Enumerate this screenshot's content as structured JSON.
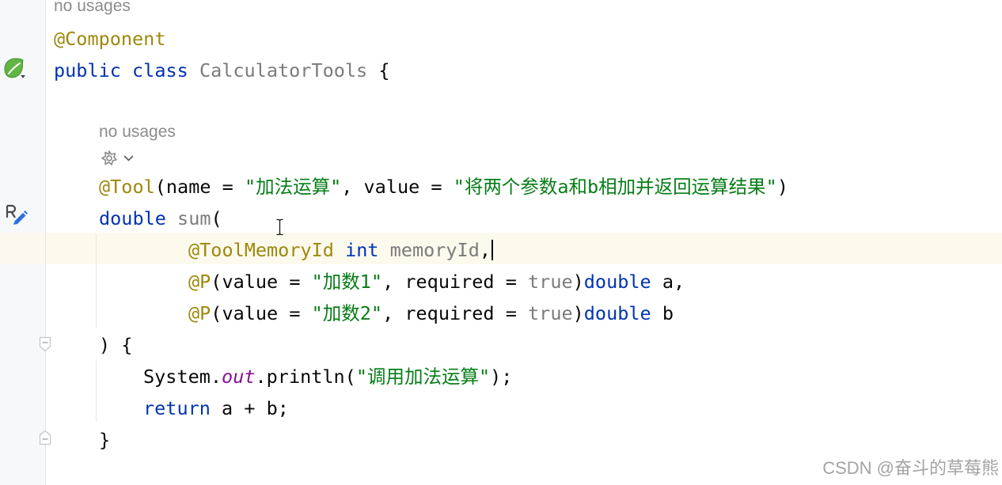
{
  "inlay_hints": {
    "class_usages": "no usages",
    "method_usages": "no usages"
  },
  "code": {
    "component_annotation": [
      "@Component"
    ],
    "class_declaration": [
      "public class ",
      "CalculatorTools",
      " {"
    ],
    "tool_annotation": [
      "@Tool",
      "(name = ",
      "\"加法运算\"",
      ", value = ",
      "\"将两个参数a和b相加并返回运算结果\"",
      ")"
    ],
    "method_signature": [
      "double ",
      "sum",
      "("
    ],
    "param_memory_id": [
      "@ToolMemoryId ",
      "int ",
      "memoryId",
      ","
    ],
    "param_a": [
      "@P",
      "(value = ",
      "\"加数1\"",
      ", required = ",
      "true",
      ")",
      "double",
      " a,"
    ],
    "param_b": [
      "@P",
      "(value = ",
      "\"加数2\"",
      ", required = ",
      "true",
      ")",
      "double",
      " b"
    ],
    "method_body_open": [
      ") {"
    ],
    "println_statement": [
      "System.",
      "out",
      ".println(",
      "\"调用加法运算\"",
      ");"
    ],
    "return_statement": [
      "return ",
      "a + b;"
    ],
    "method_close": [
      "}"
    ]
  },
  "icons": {
    "gutter": [
      "spring-bean-icon",
      "tool-method-edit-icon",
      "fold-start-icon",
      "fold-end-icon"
    ],
    "inlay": [
      "tool-icon",
      "chevron-down-icon"
    ],
    "pointer": "text-cursor-icon"
  },
  "colors": {
    "keyword": "#0033b3",
    "annotation": "#9e880d",
    "string": "#067d17",
    "unused_symbol": "#7b7b7b",
    "static_field": "#871094",
    "default_text": "#080808",
    "inlay_hint": "#8c8c8c",
    "caret_row": "#fcfaed",
    "gutter_background": "#f7f8fa"
  },
  "watermark": "CSDN @奋斗的草莓熊"
}
